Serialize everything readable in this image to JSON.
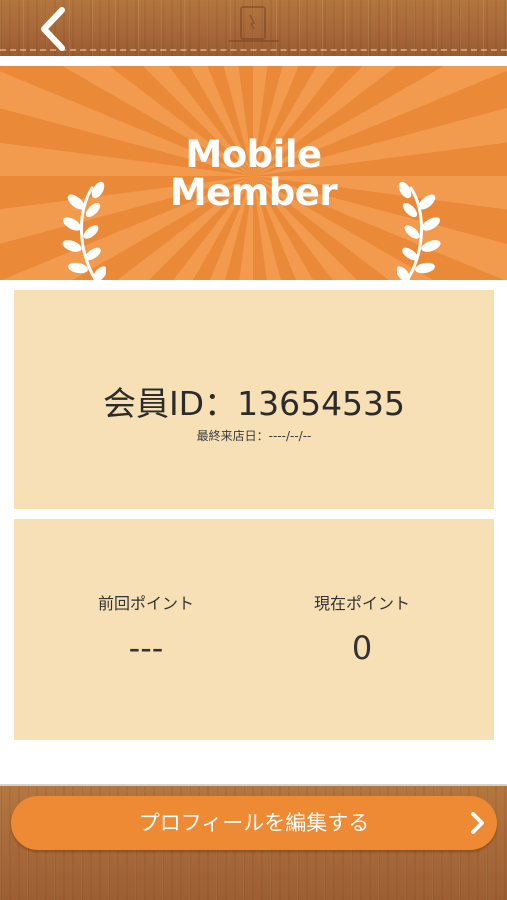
{
  "header": {
    "back_icon": "chevron-left-icon",
    "logo_icon": "tablet-logo-icon"
  },
  "hero": {
    "title_line1": "Mobile",
    "title_line2": "Member",
    "ornament_icon": "laurel-icon",
    "colors": {
      "base": "#ea8938",
      "ray": "#f29a4e"
    }
  },
  "member_card": {
    "id_text": "会員ID：13654535",
    "last_visit_text": "最終来店日：----/--/--"
  },
  "points_card": {
    "previous_label": "前回ポイント",
    "previous_value": "---",
    "current_label": "現在ポイント",
    "current_value": "0"
  },
  "footer": {
    "edit_profile_label": "プロフィールを編集する",
    "edit_profile_icon": "chevron-right-icon",
    "button_color": "#ee8a33"
  }
}
